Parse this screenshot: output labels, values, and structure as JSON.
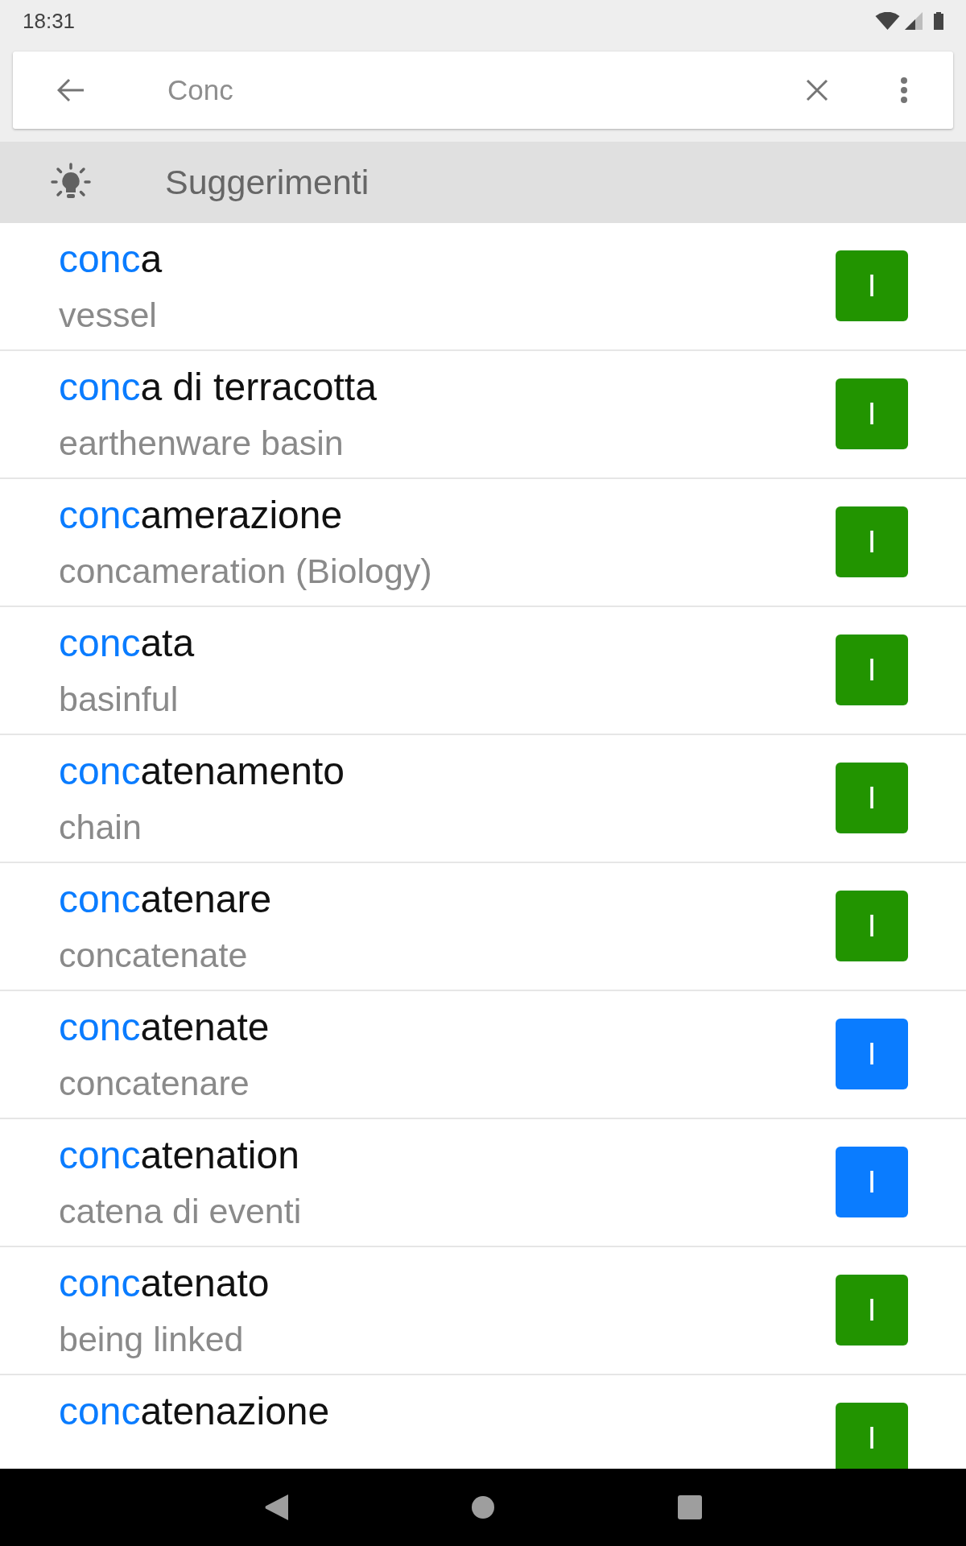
{
  "status_bar": {
    "time": "18:31"
  },
  "search": {
    "query": "Conc"
  },
  "suggestions_header": {
    "title": "Suggerimenti"
  },
  "entries": [
    {
      "match": "conc",
      "rest": "a",
      "translation": "vessel",
      "tag": "I",
      "color": "#229400"
    },
    {
      "match": "conc",
      "rest": "a di terracotta",
      "translation": "earthenware basin",
      "tag": "I",
      "color": "#229400"
    },
    {
      "match": "conc",
      "rest": "amerazione",
      "translation": "concameration (Biology)",
      "tag": "I",
      "color": "#229400"
    },
    {
      "match": "conc",
      "rest": "ata",
      "translation": "basinful",
      "tag": "I",
      "color": "#229400"
    },
    {
      "match": "conc",
      "rest": "atenamento",
      "translation": "chain",
      "tag": "I",
      "color": "#229400"
    },
    {
      "match": "conc",
      "rest": "atenare",
      "translation": "concatenate",
      "tag": "I",
      "color": "#229400"
    },
    {
      "match": "conc",
      "rest": "atenate",
      "translation": "concatenare",
      "tag": "I",
      "color": "#0a7cff"
    },
    {
      "match": "conc",
      "rest": "atenation",
      "translation": "catena di eventi",
      "tag": "I",
      "color": "#0a7cff"
    },
    {
      "match": "conc",
      "rest": "atenato",
      "translation": "being linked",
      "tag": "I",
      "color": "#229400"
    },
    {
      "match": "conc",
      "rest": "atenazione",
      "tag": "I",
      "color": "#229400"
    }
  ]
}
